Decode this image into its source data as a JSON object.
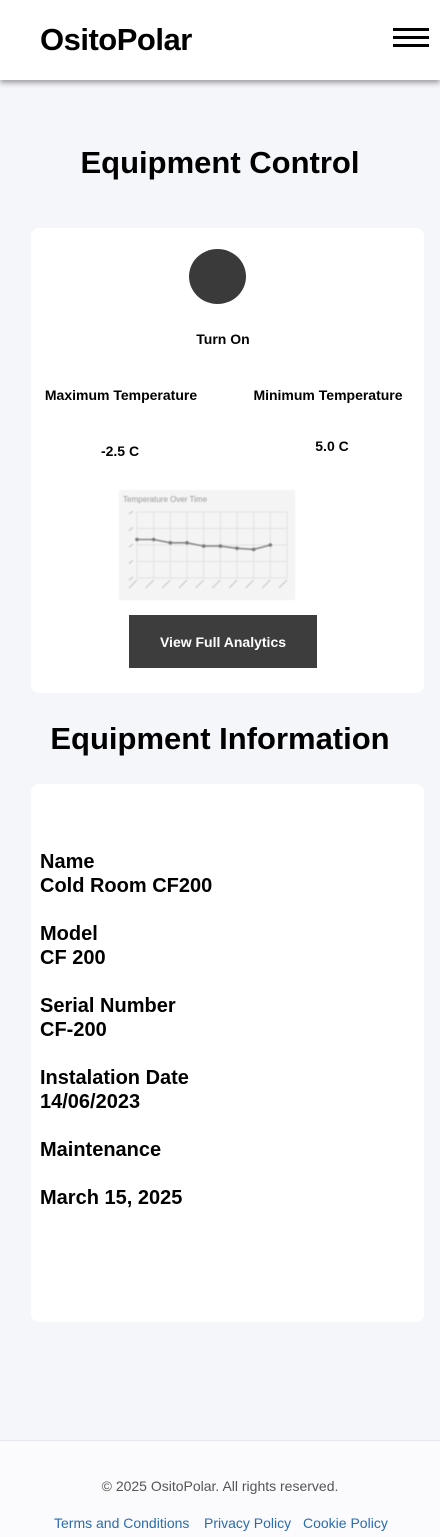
{
  "header": {
    "brand": "OsitoPolar",
    "menu_icon": "hamburger-menu-icon"
  },
  "control": {
    "title": "Equipment Control",
    "power_label": "Turn On",
    "max_label": "Maximum Temperature",
    "min_label": "Minimum Temperature",
    "max_value": "-2.5 C",
    "min_value": "5.0 C",
    "analytics_button": "View Full Analytics",
    "colors": {
      "button": "#3d3d3d",
      "power": "#3a3a3a"
    }
  },
  "chart_data": {
    "type": "line",
    "title": "Temperature Over Time",
    "x": [
      1,
      2,
      3,
      4,
      5,
      6,
      7,
      8,
      9,
      10
    ],
    "series": [
      {
        "values": [
          3.5,
          3.5,
          3.2,
          3.2,
          2.9,
          2.9,
          2.7,
          2.6,
          3.0
        ]
      }
    ],
    "ylim": [
      0,
      6
    ],
    "grid": true
  },
  "info": {
    "title": "Equipment Information",
    "name_label": "Name",
    "name_value": "Cold Room CF200",
    "model_label": "Model",
    "model_value": "CF 200",
    "serial_label": "Serial Number",
    "serial_value": "CF-200",
    "install_label": "Instalation Date",
    "install_value": "14/06/2023",
    "maintenance_label": "Maintenance",
    "maintenance_value": "March 15, 2025"
  },
  "footer": {
    "copyright": "© 2025 OsitoPolar. All rights reserved.",
    "links": [
      "Terms and Conditions",
      "Privacy Policy",
      "Cookie Policy"
    ],
    "link_color": "#2a6cb0"
  }
}
